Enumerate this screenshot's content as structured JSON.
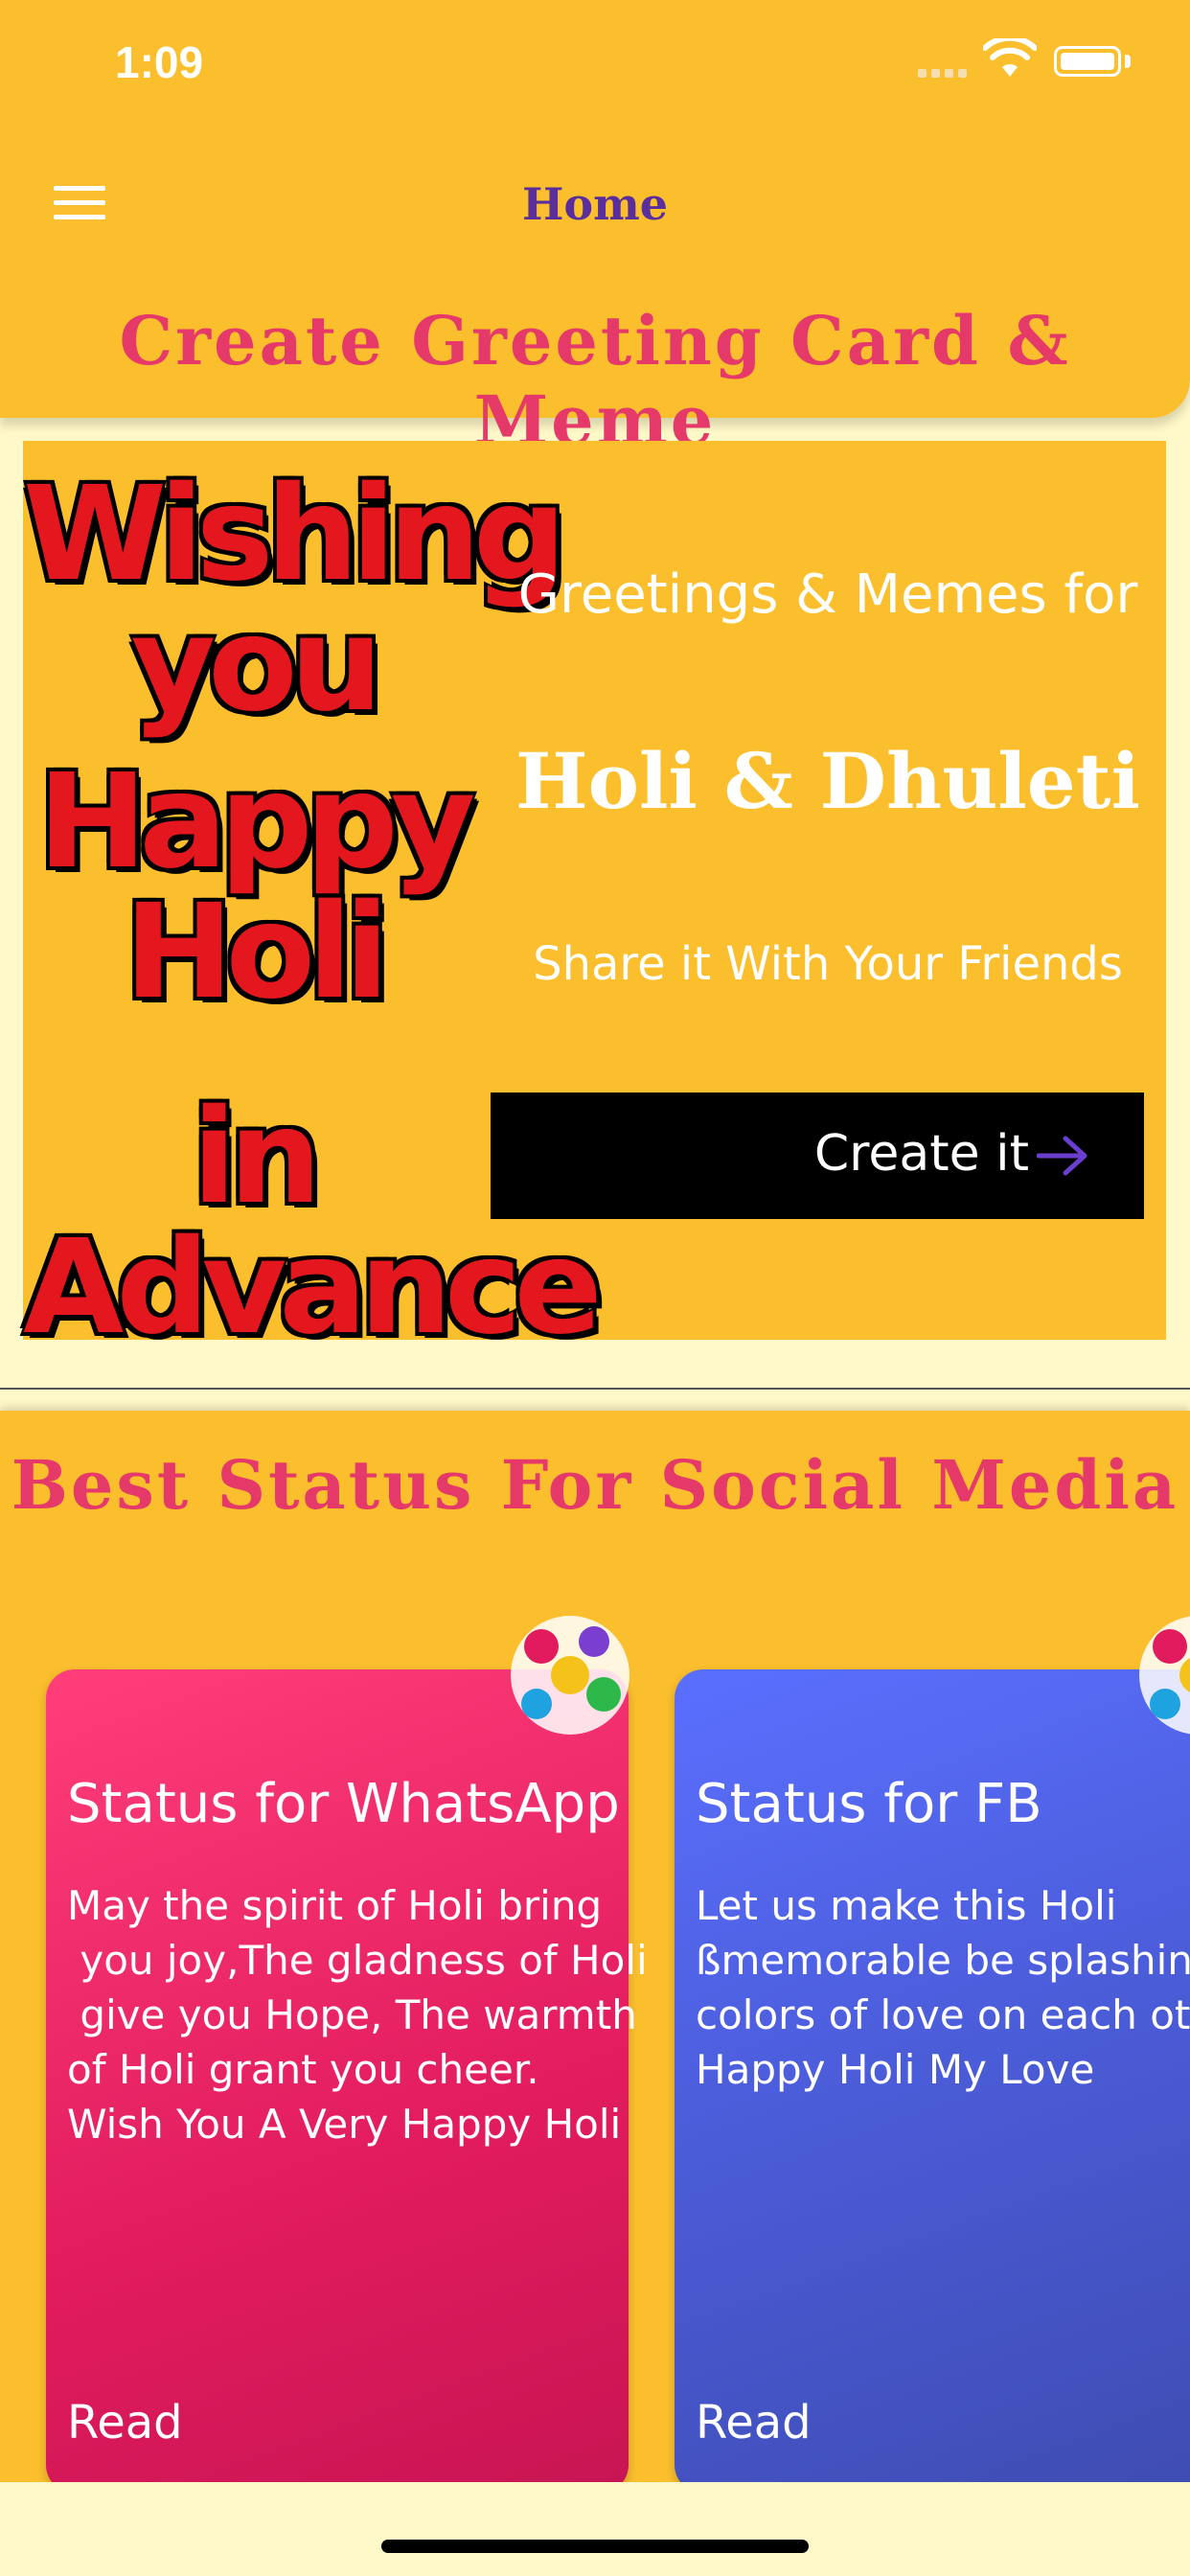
{
  "status_bar": {
    "time": "1:09"
  },
  "app_bar": {
    "title": "Home"
  },
  "greeting_section": {
    "title": "Create Greeting Card & Meme",
    "banner_art_lines": [
      "Wishing you",
      "Happy Holi",
      "in Advance"
    ],
    "subtitle": "Greetings & Memes for",
    "headline": "Holi & Dhuleti",
    "share_text": "Share it With Your Friends",
    "cta_label": "Create it"
  },
  "status_section": {
    "title": "Best Status For Social Media",
    "cards": [
      {
        "title": "Status for WhatsApp",
        "text": "May the spirit of Holi bring\n you joy,The gladness of Holi\n give you Hope, The warmth\nof Holi grant you cheer.\nWish You A Very Happy Holi",
        "read_label": "Read"
      },
      {
        "title": "Status for FB",
        "text": "Let us make this Holi\nßmemorable be splashing\ncolors of love on each other\nHappy Holi My Love",
        "read_label": "Read"
      }
    ]
  },
  "colors": {
    "primary": "#fbbf2e",
    "accent_title": "#e5396a",
    "app_title": "#5a2f9c",
    "background": "#fff8c8",
    "whatsapp_card": "#e11b5e",
    "fb_card": "#4a5bd6",
    "cta_bg": "#000000",
    "cta_arrow": "#6a3fd0"
  },
  "icons": [
    "menu-icon",
    "wifi-icon",
    "battery-icon",
    "signal-icon",
    "arrow-right-icon",
    "holi-sticker-icon"
  ]
}
